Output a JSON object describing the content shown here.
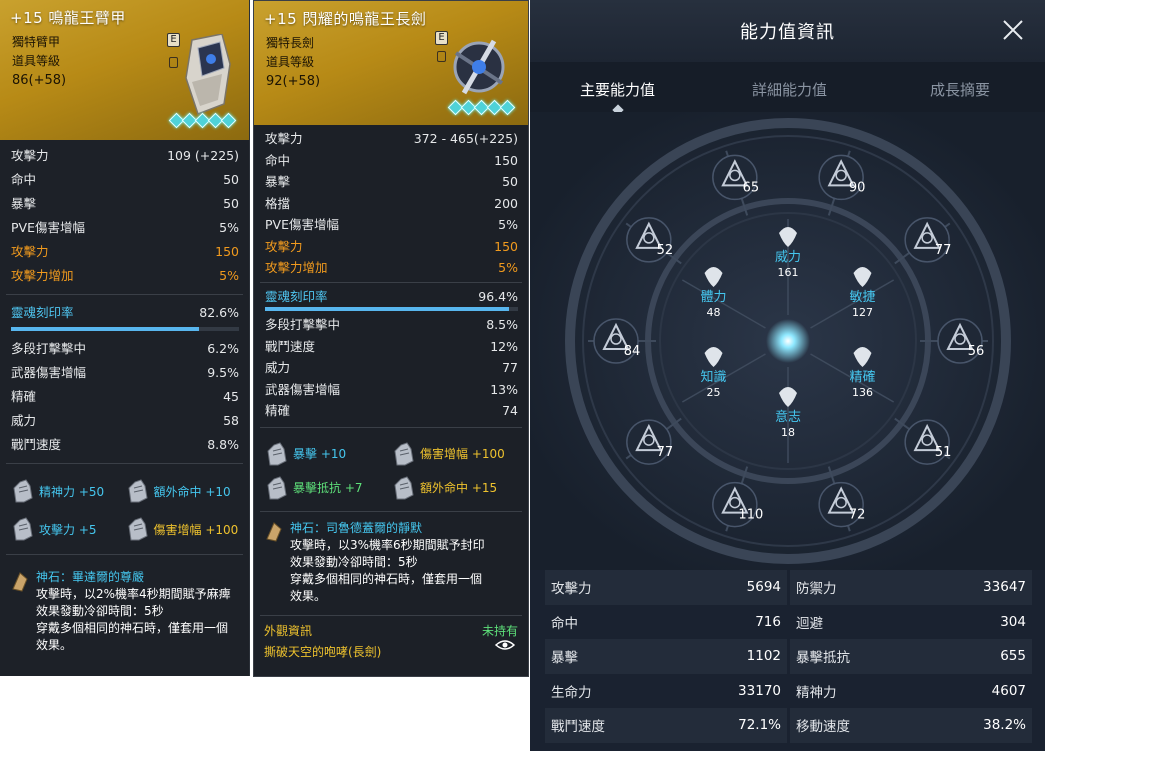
{
  "tooltip_armor": {
    "title": "+15 鳴龍王臂甲",
    "type_label": "獨特臂甲",
    "level_label": "道具等級",
    "level_value": "86(+58)",
    "badge": "E",
    "stats": [
      {
        "label": "攻擊力",
        "value": "109 (+225)",
        "style": ""
      },
      {
        "label": "命中",
        "value": "50",
        "style": ""
      },
      {
        "label": "暴擊",
        "value": "50",
        "style": ""
      },
      {
        "label": "PVE傷害增幅",
        "value": "5%",
        "style": ""
      },
      {
        "label": "攻擊力",
        "value": "150",
        "style": "orange"
      },
      {
        "label": "攻擊力增加",
        "value": "5%",
        "style": "orange"
      }
    ],
    "soul_label": "靈魂刻印率",
    "soul_value": "82.6%",
    "soul_fill": 0.826,
    "soul_stats": [
      {
        "label": "多段打擊擊中",
        "value": "6.2%"
      },
      {
        "label": "武器傷害增幅",
        "value": "9.5%"
      },
      {
        "label": "精確",
        "value": "45"
      },
      {
        "label": "威力",
        "value": "58"
      },
      {
        "label": "戰鬥速度",
        "value": "8.8%"
      }
    ],
    "engravings": [
      {
        "text": "精神力 +50",
        "color": "cyan"
      },
      {
        "text": "額外命中 +10",
        "color": "cyan"
      },
      {
        "text": "攻擊力 +5",
        "color": "cyan"
      },
      {
        "text": "傷害增幅 +100",
        "color": "yellow"
      }
    ],
    "stone_name": "神石：畢達爾的尊嚴",
    "stone_desc": "攻擊時，以2%機率4秒期間賦予麻痺\n效果發動冷卻時間：5秒\n穿戴多個相同的神石時，僅套用一個\n效果。"
  },
  "tooltip_sword": {
    "title": "+15 閃耀的鳴龍王長劍",
    "type_label": "獨特長劍",
    "level_label": "道具等級",
    "level_value": "92(+58)",
    "badge": "E",
    "stats": [
      {
        "label": "攻擊力",
        "value": "372 - 465(+225)",
        "style": ""
      },
      {
        "label": "命中",
        "value": "150",
        "style": ""
      },
      {
        "label": "暴擊",
        "value": "50",
        "style": ""
      },
      {
        "label": "格擋",
        "value": "200",
        "style": ""
      },
      {
        "label": "PVE傷害增幅",
        "value": "5%",
        "style": ""
      },
      {
        "label": "攻擊力",
        "value": "150",
        "style": "orange"
      },
      {
        "label": "攻擊力增加",
        "value": "5%",
        "style": "orange"
      }
    ],
    "soul_label": "靈魂刻印率",
    "soul_value": "96.4%",
    "soul_fill": 0.964,
    "soul_stats": [
      {
        "label": "多段打擊擊中",
        "value": "8.5%"
      },
      {
        "label": "戰鬥速度",
        "value": "12%"
      },
      {
        "label": "威力",
        "value": "77"
      },
      {
        "label": "武器傷害增幅",
        "value": "13%"
      },
      {
        "label": "精確",
        "value": "74"
      }
    ],
    "engravings": [
      {
        "text": "暴擊 +10",
        "color": "cyan"
      },
      {
        "text": "傷害增幅 +100",
        "color": "yellow"
      },
      {
        "text": "暴擊抵抗 +7",
        "color": "green"
      },
      {
        "text": "額外命中 +15",
        "color": "yellow"
      }
    ],
    "stone_name": "神石：司魯德蓋爾的靜默",
    "stone_desc": "攻擊時，以3%機率6秒期間賦予封印\n效果發動冷卻時間：5秒\n穿戴多個相同的神石時，僅套用一個\n效果。",
    "look_label": "外觀資訊",
    "look_owned": "未持有",
    "look_name": "撕破天空的咆哮(長劍)"
  },
  "stat_window": {
    "title": "能力值資訊",
    "tabs": [
      "主要能力值",
      "詳細能力值",
      "成長摘要"
    ],
    "active_tab": 0,
    "outer_ring": [
      "65",
      "90",
      "77",
      "56",
      "51",
      "72",
      "110",
      "77",
      "84",
      "52"
    ],
    "inner_stats": [
      {
        "name": "威力",
        "value": "161"
      },
      {
        "name": "敏捷",
        "value": "127"
      },
      {
        "name": "精確",
        "value": "136"
      },
      {
        "name": "意志",
        "value": "18"
      },
      {
        "name": "知識",
        "value": "25"
      },
      {
        "name": "體力",
        "value": "48"
      }
    ],
    "table": [
      [
        {
          "k": "攻擊力",
          "v": "5694"
        },
        {
          "k": "防禦力",
          "v": "33647"
        }
      ],
      [
        {
          "k": "命中",
          "v": "716"
        },
        {
          "k": "迴避",
          "v": "304"
        }
      ],
      [
        {
          "k": "暴擊",
          "v": "1102"
        },
        {
          "k": "暴擊抵抗",
          "v": "655"
        }
      ],
      [
        {
          "k": "生命力",
          "v": "33170"
        },
        {
          "k": "精神力",
          "v": "4607"
        }
      ],
      [
        {
          "k": "戰鬥速度",
          "v": "72.1%"
        },
        {
          "k": "移動速度",
          "v": "38.2%"
        }
      ]
    ],
    "colors": {
      "cyan": "#45c6ee",
      "panel": "#1a2230",
      "gold": "#c9a12e"
    }
  }
}
